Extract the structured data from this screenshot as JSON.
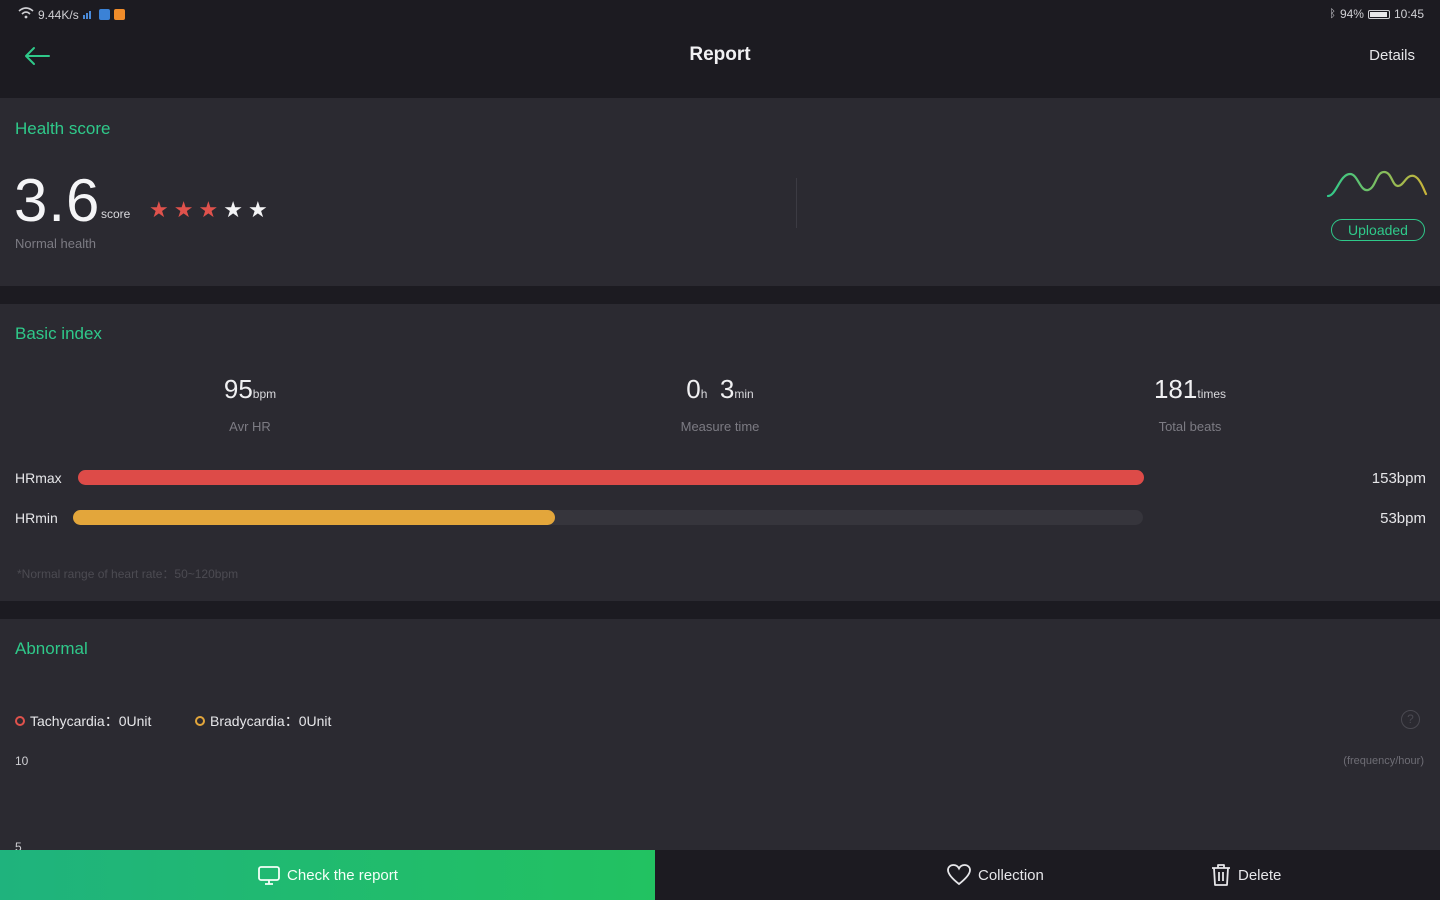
{
  "status_bar": {
    "left_text": "9.44K/s",
    "right_battery": "94%",
    "right_time": "10:45"
  },
  "app_bar": {
    "title": "Report",
    "details_label": "Details"
  },
  "health_score": {
    "title": "Health score",
    "value": "3.6",
    "unit": "score",
    "rating": 3,
    "rating_max": 5,
    "status": "Normal health",
    "badge": "Uploaded",
    "colors": {
      "accent": "#2fc98a",
      "star_on": "#e0524c",
      "star_off": "#f4f4f6"
    }
  },
  "basic_index": {
    "title": "Basic index",
    "metrics": [
      {
        "value": "95",
        "unit": "bpm",
        "label": "Avr HR"
      },
      {
        "value": "0",
        "unit_1": "h",
        "value_2": "3",
        "unit_2": "min",
        "label": "Measure time"
      },
      {
        "value": "181",
        "unit": "times",
        "label": "Total beats"
      }
    ],
    "hr_max": {
      "label": "HRmax",
      "value": "153bpm",
      "fraction": 1.0,
      "color": "#dd4b48"
    },
    "hr_min": {
      "label": "HRmin",
      "value": "53bpm",
      "fraction": 0.45,
      "color": "#e3a63b"
    },
    "footnote": "*Normal range of heart rate：50~120bpm"
  },
  "abnormal": {
    "title": "Abnormal",
    "tachycardia": {
      "label": "Tachycardia：0Unit",
      "color": "#e0524c"
    },
    "bradycardia": {
      "label": "Bradycardia：0Unit",
      "color": "#e3a63b"
    },
    "help": "?",
    "axis_top": "10",
    "axis_mid": "5",
    "axis_unit": "(frequency/hour)"
  },
  "bottom_bar": {
    "check_report": "Check the report",
    "collection": "Collection",
    "delete": "Delete"
  }
}
